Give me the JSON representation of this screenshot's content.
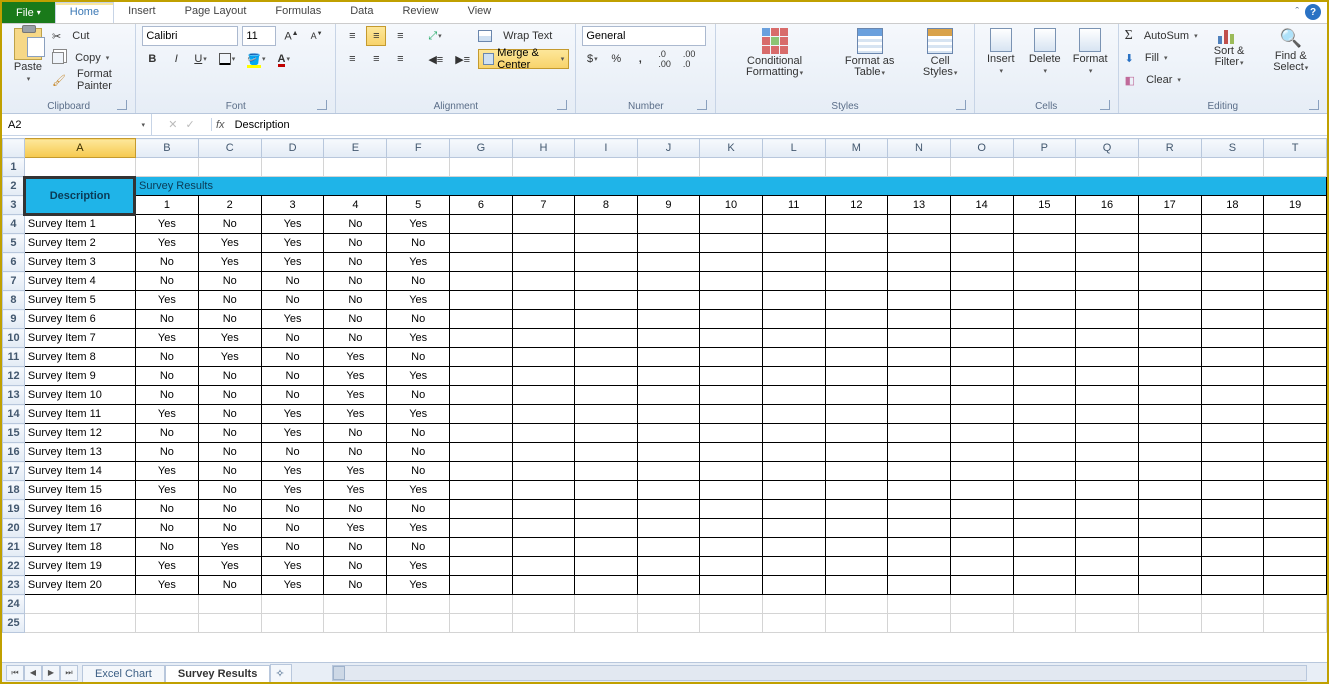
{
  "menubar": {
    "file": "File",
    "tabs": [
      "Home",
      "Insert",
      "Page Layout",
      "Formulas",
      "Data",
      "Review",
      "View"
    ],
    "active": "Home"
  },
  "ribbon": {
    "clipboard": {
      "paste": "Paste",
      "cut": "Cut",
      "copy": "Copy",
      "painter": "Format Painter",
      "label": "Clipboard"
    },
    "font": {
      "name": "Calibri",
      "size": "11",
      "label": "Font"
    },
    "alignment": {
      "wrap": "Wrap Text",
      "merge": "Merge & Center",
      "label": "Alignment"
    },
    "number": {
      "format": "General",
      "label": "Number"
    },
    "styles": {
      "cond": "Conditional Formatting",
      "table": "Format as Table",
      "cell": "Cell Styles",
      "label": "Styles"
    },
    "cells": {
      "insert": "Insert",
      "delete": "Delete",
      "format": "Format",
      "label": "Cells"
    },
    "editing": {
      "sum": "AutoSum",
      "fill": "Fill",
      "clear": "Clear",
      "sort": "Sort & Filter",
      "find": "Find & Select",
      "label": "Editing"
    }
  },
  "formula_bar": {
    "name_box": "A2",
    "fx": "fx",
    "value": "Description"
  },
  "columns": [
    "A",
    "B",
    "C",
    "D",
    "E",
    "F",
    "G",
    "H",
    "I",
    "J",
    "K",
    "L",
    "M",
    "N",
    "O",
    "P",
    "Q",
    "R",
    "S",
    "T"
  ],
  "selected_col": "A",
  "selected_cell": "A2",
  "header": {
    "description": "Description",
    "title": "Survey Results",
    "numbers": [
      "1",
      "2",
      "3",
      "4",
      "5",
      "6",
      "7",
      "8",
      "9",
      "10",
      "11",
      "12",
      "13",
      "14",
      "15",
      "16",
      "17",
      "18",
      "19"
    ]
  },
  "rows": [
    {
      "label": "Survey Item 1",
      "v": [
        "Yes",
        "No",
        "Yes",
        "No",
        "Yes"
      ]
    },
    {
      "label": "Survey Item 2",
      "v": [
        "Yes",
        "Yes",
        "Yes",
        "No",
        "No"
      ]
    },
    {
      "label": "Survey Item 3",
      "v": [
        "No",
        "Yes",
        "Yes",
        "No",
        "Yes"
      ]
    },
    {
      "label": "Survey Item 4",
      "v": [
        "No",
        "No",
        "No",
        "No",
        "No"
      ]
    },
    {
      "label": "Survey Item 5",
      "v": [
        "Yes",
        "No",
        "No",
        "No",
        "Yes"
      ]
    },
    {
      "label": "Survey Item 6",
      "v": [
        "No",
        "No",
        "Yes",
        "No",
        "No"
      ]
    },
    {
      "label": "Survey Item 7",
      "v": [
        "Yes",
        "Yes",
        "No",
        "No",
        "Yes"
      ]
    },
    {
      "label": "Survey Item 8",
      "v": [
        "No",
        "Yes",
        "No",
        "Yes",
        "No"
      ]
    },
    {
      "label": "Survey Item 9",
      "v": [
        "No",
        "No",
        "No",
        "Yes",
        "Yes"
      ]
    },
    {
      "label": "Survey Item 10",
      "v": [
        "No",
        "No",
        "No",
        "Yes",
        "No"
      ]
    },
    {
      "label": "Survey Item 11",
      "v": [
        "Yes",
        "No",
        "Yes",
        "Yes",
        "Yes"
      ]
    },
    {
      "label": "Survey Item 12",
      "v": [
        "No",
        "No",
        "Yes",
        "No",
        "No"
      ]
    },
    {
      "label": "Survey Item 13",
      "v": [
        "No",
        "No",
        "No",
        "No",
        "No"
      ]
    },
    {
      "label": "Survey Item 14",
      "v": [
        "Yes",
        "No",
        "Yes",
        "Yes",
        "No"
      ]
    },
    {
      "label": "Survey Item 15",
      "v": [
        "Yes",
        "No",
        "Yes",
        "Yes",
        "Yes"
      ]
    },
    {
      "label": "Survey Item 16",
      "v": [
        "No",
        "No",
        "No",
        "No",
        "No"
      ]
    },
    {
      "label": "Survey Item 17",
      "v": [
        "No",
        "No",
        "No",
        "Yes",
        "Yes"
      ]
    },
    {
      "label": "Survey Item 18",
      "v": [
        "No",
        "Yes",
        "No",
        "No",
        "No"
      ]
    },
    {
      "label": "Survey Item 19",
      "v": [
        "Yes",
        "Yes",
        "Yes",
        "No",
        "Yes"
      ]
    },
    {
      "label": "Survey Item 20",
      "v": [
        "Yes",
        "No",
        "Yes",
        "No",
        "Yes"
      ]
    }
  ],
  "sheet_tabs": {
    "tabs": [
      "Excel Chart",
      "Survey Results"
    ],
    "active": "Survey Results"
  }
}
